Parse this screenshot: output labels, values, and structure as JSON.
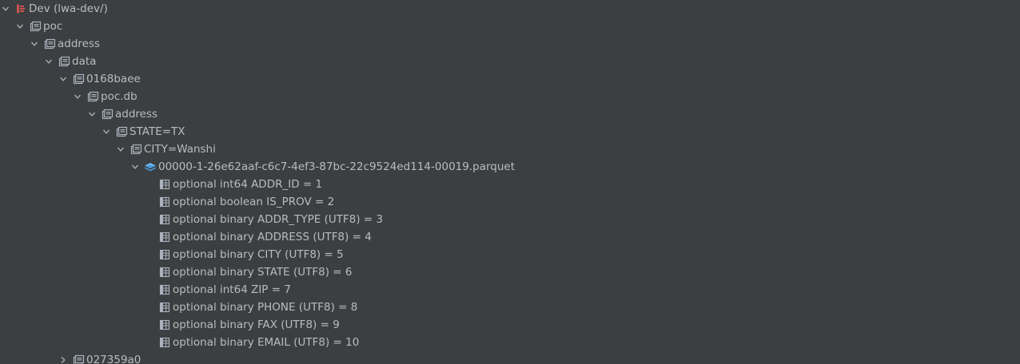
{
  "tree": {
    "root": {
      "label": "Dev (lwa-dev/)",
      "icon": "hdfs-root-icon",
      "expanded": true
    },
    "poc": {
      "label": "poc",
      "icon": "folder-icon",
      "expanded": true
    },
    "address": {
      "label": "address",
      "icon": "folder-icon",
      "expanded": true
    },
    "data": {
      "label": "data",
      "icon": "folder-icon",
      "expanded": true
    },
    "dir1": {
      "label": "0168baee",
      "icon": "folder-icon",
      "expanded": true
    },
    "db": {
      "label": "poc.db",
      "icon": "folder-icon",
      "expanded": true
    },
    "address2": {
      "label": "address",
      "icon": "folder-icon",
      "expanded": true
    },
    "state": {
      "label": "STATE=TX",
      "icon": "folder-icon",
      "expanded": true
    },
    "city": {
      "label": "CITY=Wanshi",
      "icon": "folder-icon",
      "expanded": true
    },
    "file": {
      "label": "00000-1-26e62aaf-c6c7-4ef3-87bc-22c9524ed114-00019.parquet",
      "icon": "parquet-file-icon",
      "expanded": true
    },
    "columns": [
      {
        "label": "optional int64 ADDR_ID = 1"
      },
      {
        "label": "optional boolean IS_PROV = 2"
      },
      {
        "label": "optional binary ADDR_TYPE (UTF8) = 3"
      },
      {
        "label": "optional binary ADDRESS (UTF8) = 4"
      },
      {
        "label": "optional binary CITY (UTF8) = 5"
      },
      {
        "label": "optional binary STATE (UTF8) = 6"
      },
      {
        "label": "optional int64 ZIP = 7"
      },
      {
        "label": "optional binary PHONE (UTF8) = 8"
      },
      {
        "label": "optional binary FAX (UTF8) = 9"
      },
      {
        "label": "optional binary EMAIL (UTF8) = 10"
      }
    ],
    "sibling": {
      "label": "027359a0",
      "icon": "folder-icon",
      "expanded": false
    }
  },
  "colors": {
    "background": "#3c3f41",
    "text": "#bbbbbb",
    "root_icon": "#c75450",
    "parquet_icon": "#4a9fe0"
  }
}
